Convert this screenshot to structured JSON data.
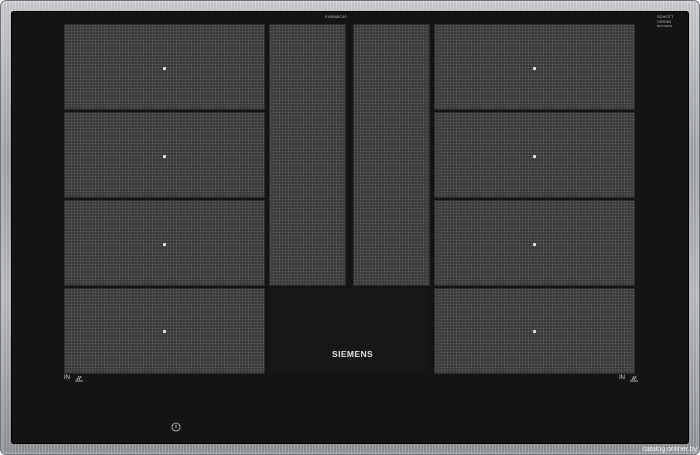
{
  "hob": {
    "model_code": "EX8040C40",
    "brand": "SIEMENS",
    "glass_logo": {
      "line1": "SCHOTT",
      "line2": "CERAN",
      "line3": "BOTTIEUS"
    },
    "left_indicator": "IN",
    "right_indicator": "IN"
  },
  "watermark": "catalog.onliner.by",
  "colors": {
    "glass": "#141414",
    "cooking_zone": "#3b3b3b",
    "zone_marker": "#e8e8e8",
    "frame": "#a8abae"
  },
  "icons": {
    "power": "power-touch-icon",
    "induction": "induction-symbol-icon"
  }
}
